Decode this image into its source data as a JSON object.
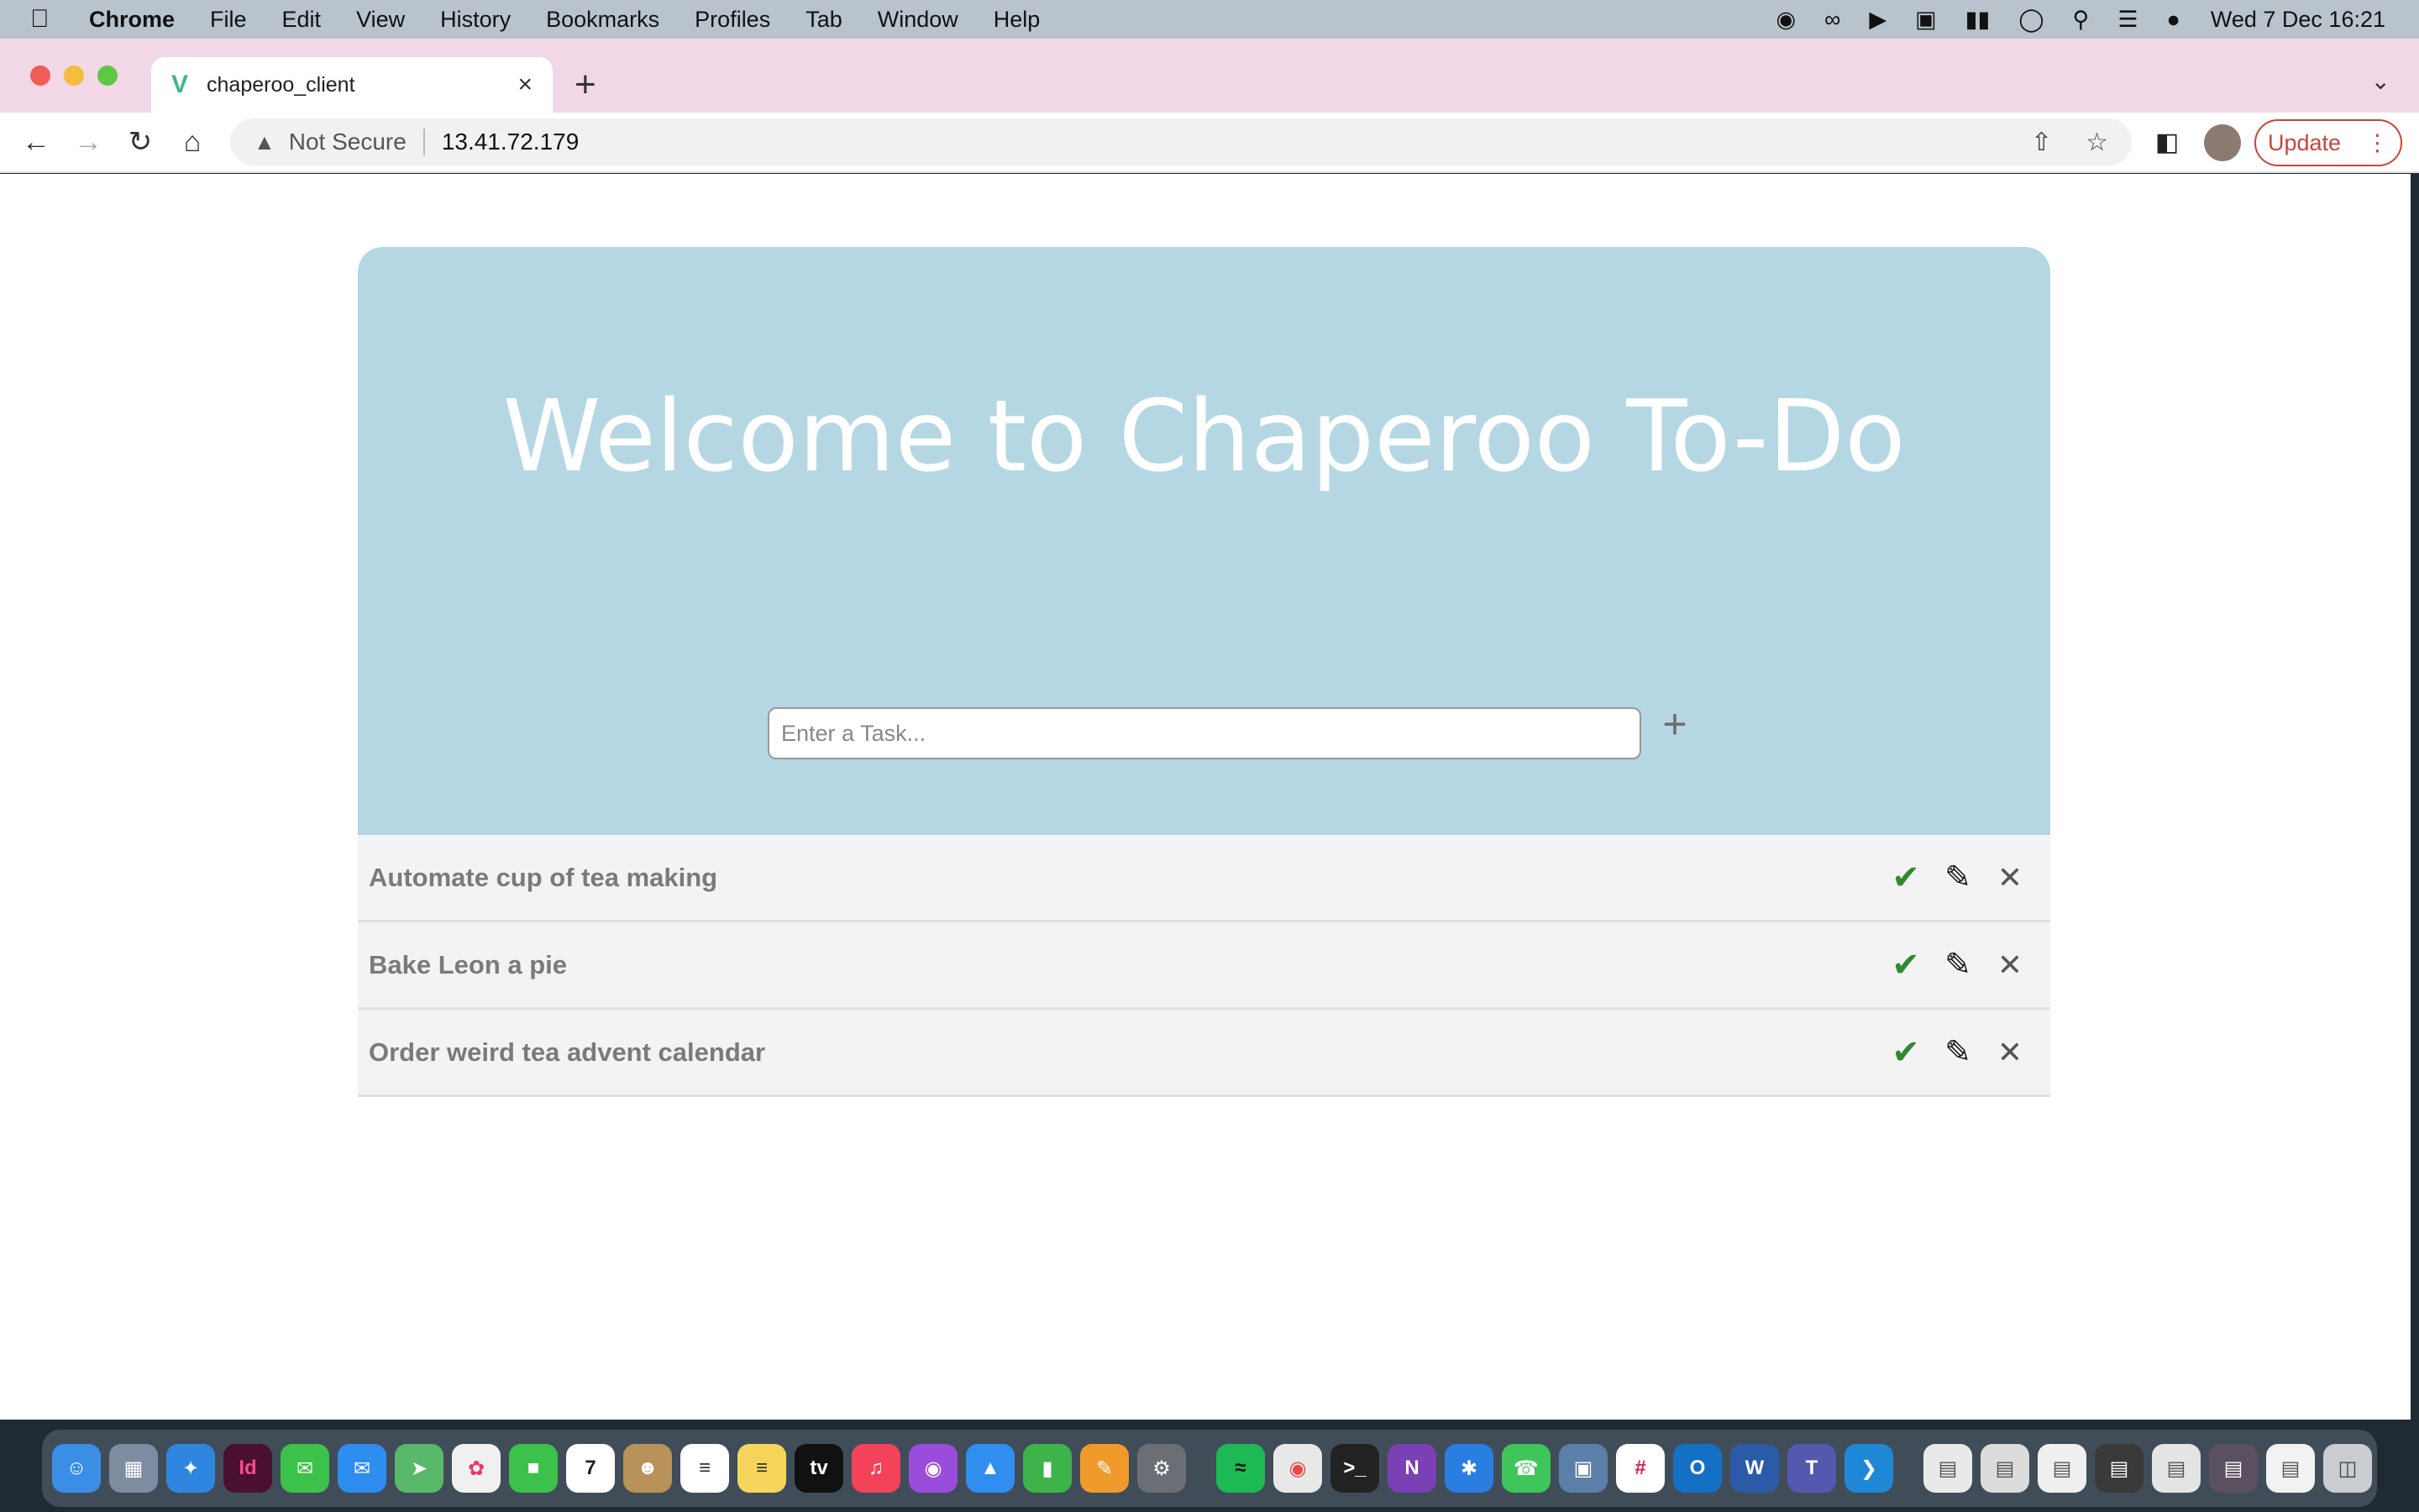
{
  "menubar": {
    "app_name": "Chrome",
    "items": [
      "File",
      "Edit",
      "View",
      "History",
      "Bookmarks",
      "Profiles",
      "Tab",
      "Window",
      "Help"
    ],
    "clock": "Wed 7 Dec  16:21"
  },
  "browser": {
    "tab_title": "chaperoo_client",
    "security_label": "Not Secure",
    "url": "13.41.72.179",
    "update_label": "Update"
  },
  "page": {
    "heading": "Welcome to Chaperoo To-Do",
    "input_placeholder": "Enter a Task...",
    "tasks": [
      "Automate cup of tea making",
      "Bake Leon a pie",
      "Order weird tea advent calendar"
    ]
  },
  "colors": {
    "hero_bg": "#b4d7e3",
    "check": "#2e8a2e",
    "update_accent": "#c7453a"
  }
}
